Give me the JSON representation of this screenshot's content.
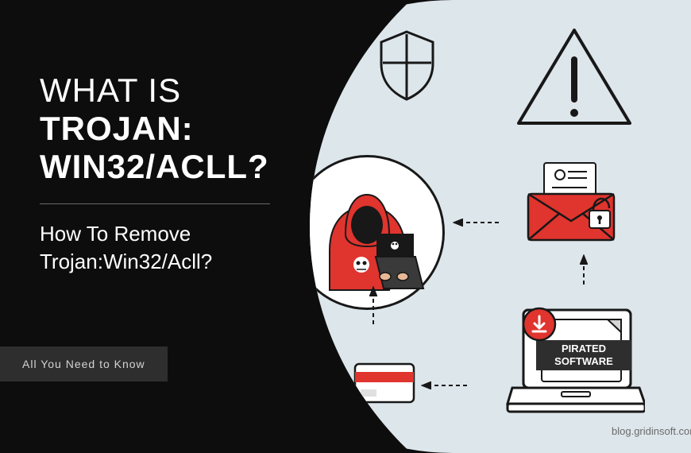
{
  "heading": {
    "line1": "WHAT IS",
    "line2": "TROJAN:",
    "line3": "WIN32/ACLL?"
  },
  "subtitle": {
    "line1": "How To Remove",
    "line2": "Trojan:Win32/Acll?"
  },
  "tag": "All You Need to Know",
  "laptop_label_1": "PIRATED",
  "laptop_label_2": "SOFTWARE",
  "watermark": "blog.gridinsoft.com",
  "icons": {
    "shield": "shield-icon",
    "warning": "warning-triangle-icon",
    "hacker": "hacker-icon",
    "envelope": "phishing-envelope-icon",
    "laptop": "pirated-software-laptop-icon",
    "credit_card": "credit-card-icon",
    "download": "download-icon"
  },
  "colors": {
    "bg_dark": "#0d0d0d",
    "bg_light": "#dde6eb",
    "accent_red": "#e0342e",
    "stroke": "#181818"
  }
}
